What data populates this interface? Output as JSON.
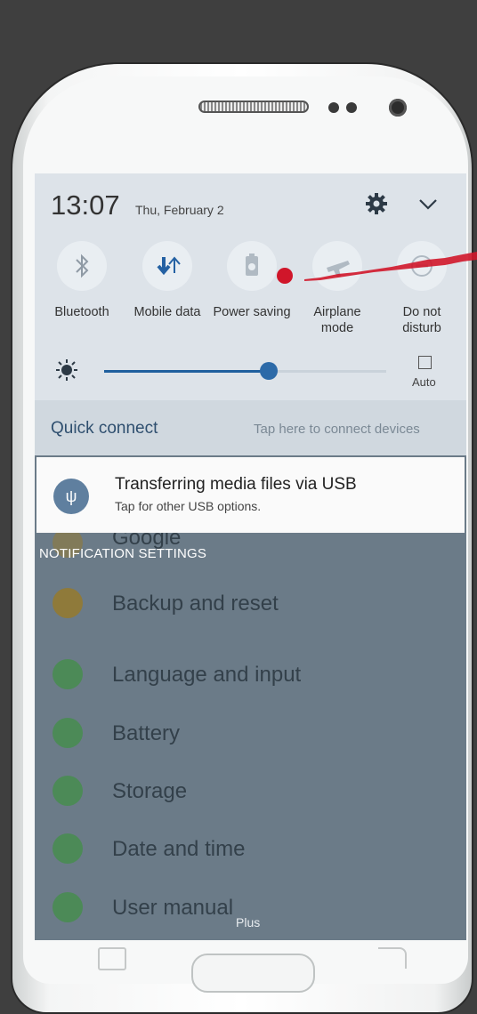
{
  "status": {
    "time": "13:07",
    "date": "Thu, February 2"
  },
  "icons": {
    "settings": "gear-icon",
    "expand": "chevron-down-icon"
  },
  "toggles": [
    {
      "label": "Bluetooth",
      "icon": "bluetooth-icon"
    },
    {
      "label": "Mobile data",
      "icon": "mobile-data-icon"
    },
    {
      "label": "Power saving",
      "icon": "power-saving-icon"
    },
    {
      "label": "Airplane mode",
      "icon": "airplane-icon"
    },
    {
      "label": "Do not disturb",
      "icon": "do-not-disturb-icon"
    }
  ],
  "brightness": {
    "level": 0.6,
    "auto_label": "Auto",
    "auto_checked": false
  },
  "quick_connect": {
    "title": "Quick connect",
    "hint": "Tap here to connect devices"
  },
  "notification": {
    "title": "Transferring media files via USB",
    "subtitle": "Tap for other USB options.",
    "icon": "usb-icon"
  },
  "notification_settings_label": "NOTIFICATION SETTINGS",
  "settings_list": [
    {
      "label": "Google",
      "color": "#8f7a3a"
    },
    {
      "label": "Backup and reset",
      "color": "#8f7a3a"
    },
    {
      "label": "Language and input",
      "color": "#4c8a57"
    },
    {
      "label": "Battery",
      "color": "#4c8a57"
    },
    {
      "label": "Storage",
      "color": "#4c8a57"
    },
    {
      "label": "Date and time",
      "color": "#4c8a57"
    },
    {
      "label": "User manual",
      "color": "#4c8a57"
    }
  ],
  "footer_plus": "Plus",
  "colors": {
    "accent": "#1f5f9e",
    "marker": "#d0162a"
  }
}
